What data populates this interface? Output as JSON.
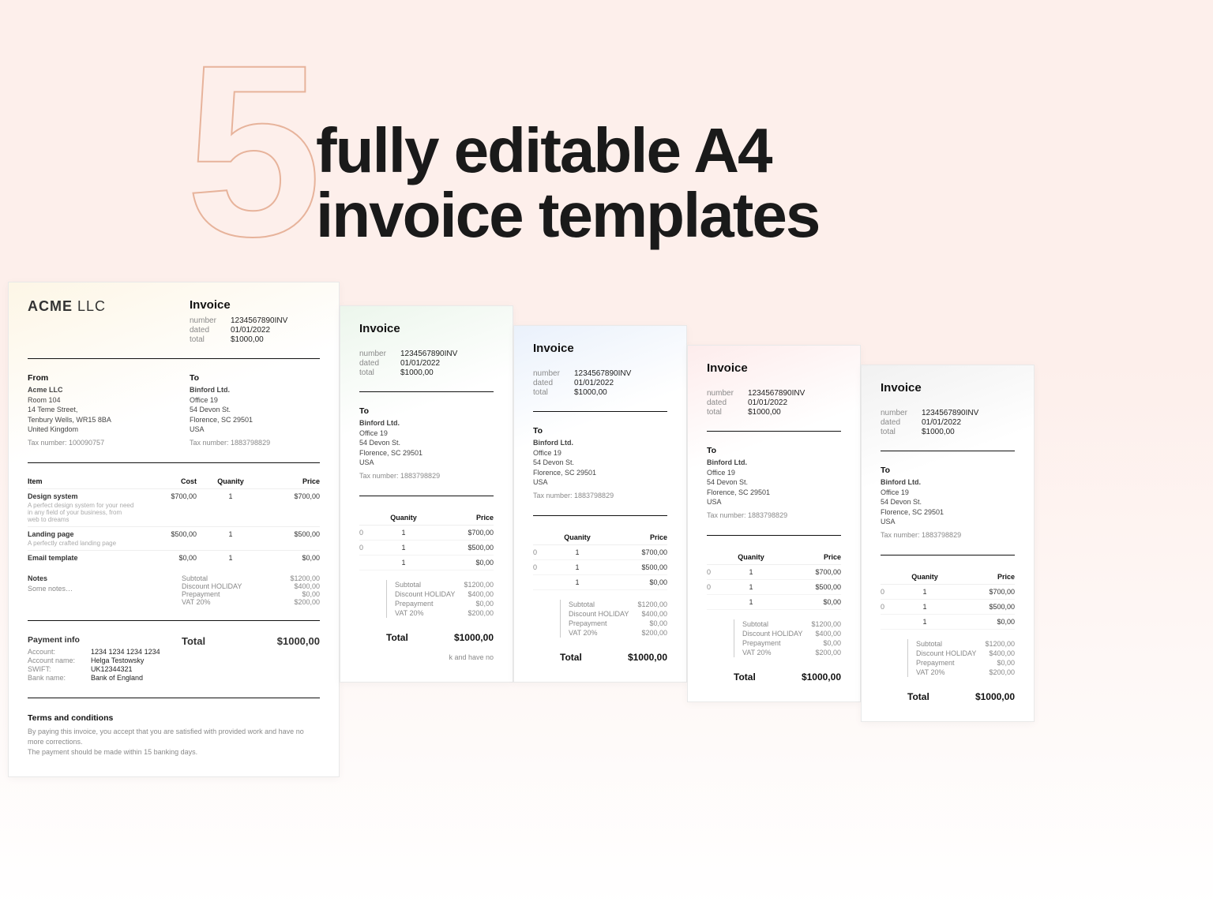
{
  "hero": {
    "big": "5",
    "line1": "fully editable A4",
    "line2": "invoice templates"
  },
  "labels": {
    "invoice": "Invoice",
    "number": "number",
    "dated": "dated",
    "total": "total",
    "from": "From",
    "to": "To",
    "item": "Item",
    "cost": "Cost",
    "quantity": "Quanity",
    "price": "Price",
    "notes": "Notes",
    "subtotal": "Subtotal",
    "discount": "Discount",
    "prepay": "Prepayment",
    "vat": "VAT",
    "totalBig": "Total",
    "payInfo": "Payment info",
    "account": "Account:",
    "accountName": "Account name:",
    "swift": "SWIFT:",
    "bank": "Bank name:",
    "terms": "Terms and conditions"
  },
  "invoice": {
    "brand_bold": "ACME",
    "brand_thin": "LLC",
    "number": "1234567890INV",
    "dated": "01/01/2022",
    "total": "$1000,00",
    "discount_code": "HOLIDAY",
    "vat_rate": "20%",
    "from": {
      "name": "Acme LLC",
      "l1": "Room 104",
      "l2": "14 Teme Street,",
      "l3": "Tenbury Wells, WR15 8BA",
      "l4": "United Kingdom",
      "tax": "Tax number: 100090757"
    },
    "to": {
      "name": "Binford Ltd.",
      "l1": "Office 19",
      "l2": "54 Devon St.",
      "l3": "Florence, SC 29501",
      "l4": "USA",
      "tax": "Tax number: 1883798829"
    },
    "items": [
      {
        "name": "Design system",
        "desc": "A perfect design system for your need in any field of your business, from web to dreams",
        "cost": "$700,00",
        "qty": "1",
        "price": "$700,00"
      },
      {
        "name": "Landing page",
        "desc": "A perfectly crafted landing page",
        "cost": "$500,00",
        "qty": "1",
        "price": "$500,00"
      },
      {
        "name": "Email template",
        "desc": "",
        "cost": "$0,00",
        "qty": "1",
        "price": "$0,00"
      }
    ],
    "sums": {
      "subtotal": "$1200,00",
      "discount": "$400,00",
      "prepay": "$0,00",
      "vat": "$200,00"
    },
    "pay": {
      "account": "1234 1234 1234 1234",
      "name": "Helga Testowsky",
      "swift": "UK12344321",
      "bank": "Bank of England"
    },
    "terms": {
      "l1": "By paying this invoice, you accept that you are satisfied with provided work and have no more corrections.",
      "l2": "The payment should be made within 15 banking days."
    },
    "notes_text": "Some notes…",
    "terms_frag": "k and have no"
  },
  "mini_rows": [
    {
      "zero": "0",
      "qty": "1",
      "price": "$700,00"
    },
    {
      "zero": "0",
      "qty": "1",
      "price": "$500,00"
    },
    {
      "zero": "",
      "qty": "1",
      "price": "$0,00"
    }
  ]
}
